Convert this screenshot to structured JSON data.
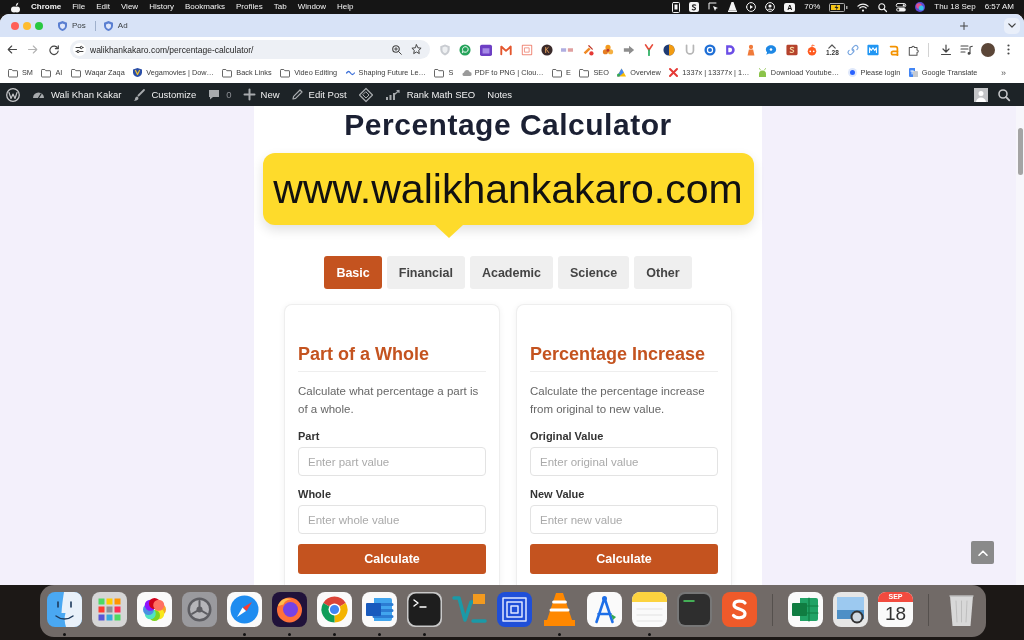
{
  "menu_bar": {
    "menus": [
      {
        "label": "Chrome",
        "kind": "app"
      },
      {
        "label": "File",
        "kind": "menu"
      },
      {
        "label": "Edit",
        "kind": "menu"
      },
      {
        "label": "View",
        "kind": "menu"
      },
      {
        "label": "History",
        "kind": "menu"
      },
      {
        "label": "Bookmarks",
        "kind": "menu"
      },
      {
        "label": "Profiles",
        "kind": "menu"
      },
      {
        "label": "Tab",
        "kind": "menu"
      },
      {
        "label": "Window",
        "kind": "menu"
      },
      {
        "label": "Help",
        "kind": "menu"
      }
    ],
    "input_source": "A",
    "battery": "70%",
    "date": "Thu 18 Sep",
    "time": "6:57 AM"
  },
  "browser": {
    "tabs": [
      {
        "title": "Pos"
      },
      {
        "title": "Ad"
      }
    ],
    "address": "walikhankakaro.com/percentage-calculator/",
    "extension_badge": "1.28",
    "bookmarks": [
      {
        "kind": "folder",
        "title": "SM"
      },
      {
        "kind": "folder",
        "title": "AI"
      },
      {
        "kind": "folder",
        "title": "Waqar Zaqa"
      },
      {
        "kind": "site",
        "title": "Vegamovies | Dow…"
      },
      {
        "kind": "folder",
        "title": "Back Links"
      },
      {
        "kind": "folder",
        "title": "Video Editing"
      },
      {
        "kind": "site",
        "title": "Shaping Future Le…"
      },
      {
        "kind": "folder",
        "title": "S"
      },
      {
        "kind": "site",
        "title": "PDF to PNG | Clou…"
      },
      {
        "kind": "folder",
        "title": "E"
      },
      {
        "kind": "folder",
        "title": "SEO"
      },
      {
        "kind": "site",
        "title": "Overview"
      },
      {
        "kind": "site",
        "title": "1337x | 13377x | 1…"
      },
      {
        "kind": "site",
        "title": "Download Youtube…"
      },
      {
        "kind": "site",
        "title": "Please login"
      },
      {
        "kind": "site",
        "title": "Google Translate"
      }
    ],
    "bookmarks_more": "»"
  },
  "admin_bar": {
    "items": [
      {
        "kind": "site",
        "label": "Wali Khan Kakar"
      },
      {
        "kind": "customize",
        "label": "Customize"
      },
      {
        "kind": "comments",
        "label": "0"
      },
      {
        "kind": "new",
        "label": "New"
      },
      {
        "kind": "edit",
        "label": "Edit Post"
      },
      {
        "kind": "translate"
      },
      {
        "kind": "seo",
        "label": "Rank Math SEO"
      },
      {
        "kind": "notes",
        "label": "Notes"
      }
    ]
  },
  "page": {
    "title": "Percentage Calculator",
    "callout": "www.walikhankakaro.com",
    "tabs": [
      {
        "label": "Basic",
        "selected": true
      },
      {
        "label": "Financial",
        "selected": false
      },
      {
        "label": "Academic",
        "selected": false
      },
      {
        "label": "Science",
        "selected": false
      },
      {
        "label": "Other",
        "selected": false
      }
    ],
    "cards": [
      {
        "title": "Part of a Whole",
        "description": "Calculate what percentage a part is of a whole.",
        "fields": [
          {
            "label": "Part",
            "placeholder": "Enter part value"
          },
          {
            "label": "Whole",
            "placeholder": "Enter whole value"
          }
        ],
        "button": "Calculate"
      },
      {
        "title": "Percentage Increase",
        "description": "Calculate the percentage increase from original to new value.",
        "fields": [
          {
            "label": "Original Value",
            "placeholder": "Enter original value"
          },
          {
            "label": "New Value",
            "placeholder": "Enter new value"
          }
        ],
        "button": "Calculate"
      }
    ]
  },
  "dock": {
    "apps": [
      {
        "kind": "finder",
        "running": true
      },
      {
        "kind": "launchpad",
        "running": false
      },
      {
        "kind": "photos",
        "running": false
      },
      {
        "kind": "settings",
        "running": false
      },
      {
        "kind": "safari",
        "running": true
      },
      {
        "kind": "firefox",
        "running": true
      },
      {
        "kind": "chrome",
        "running": true
      },
      {
        "kind": "word",
        "running": true
      },
      {
        "kind": "terminal",
        "running": true
      },
      {
        "kind": "vs",
        "running": false
      },
      {
        "kind": "remote",
        "running": false
      },
      {
        "kind": "vlc",
        "running": true
      },
      {
        "kind": "instruments",
        "running": false
      },
      {
        "kind": "notes",
        "running": true
      },
      {
        "kind": "console",
        "running": false
      },
      {
        "kind": "slides",
        "running": false
      },
      {
        "kind": "separator"
      },
      {
        "kind": "excel",
        "running": false
      },
      {
        "kind": "preview",
        "running": false
      },
      {
        "kind": "calendar",
        "running": false,
        "month": "SEP",
        "day": "18"
      },
      {
        "kind": "separator"
      },
      {
        "kind": "trash"
      }
    ]
  }
}
